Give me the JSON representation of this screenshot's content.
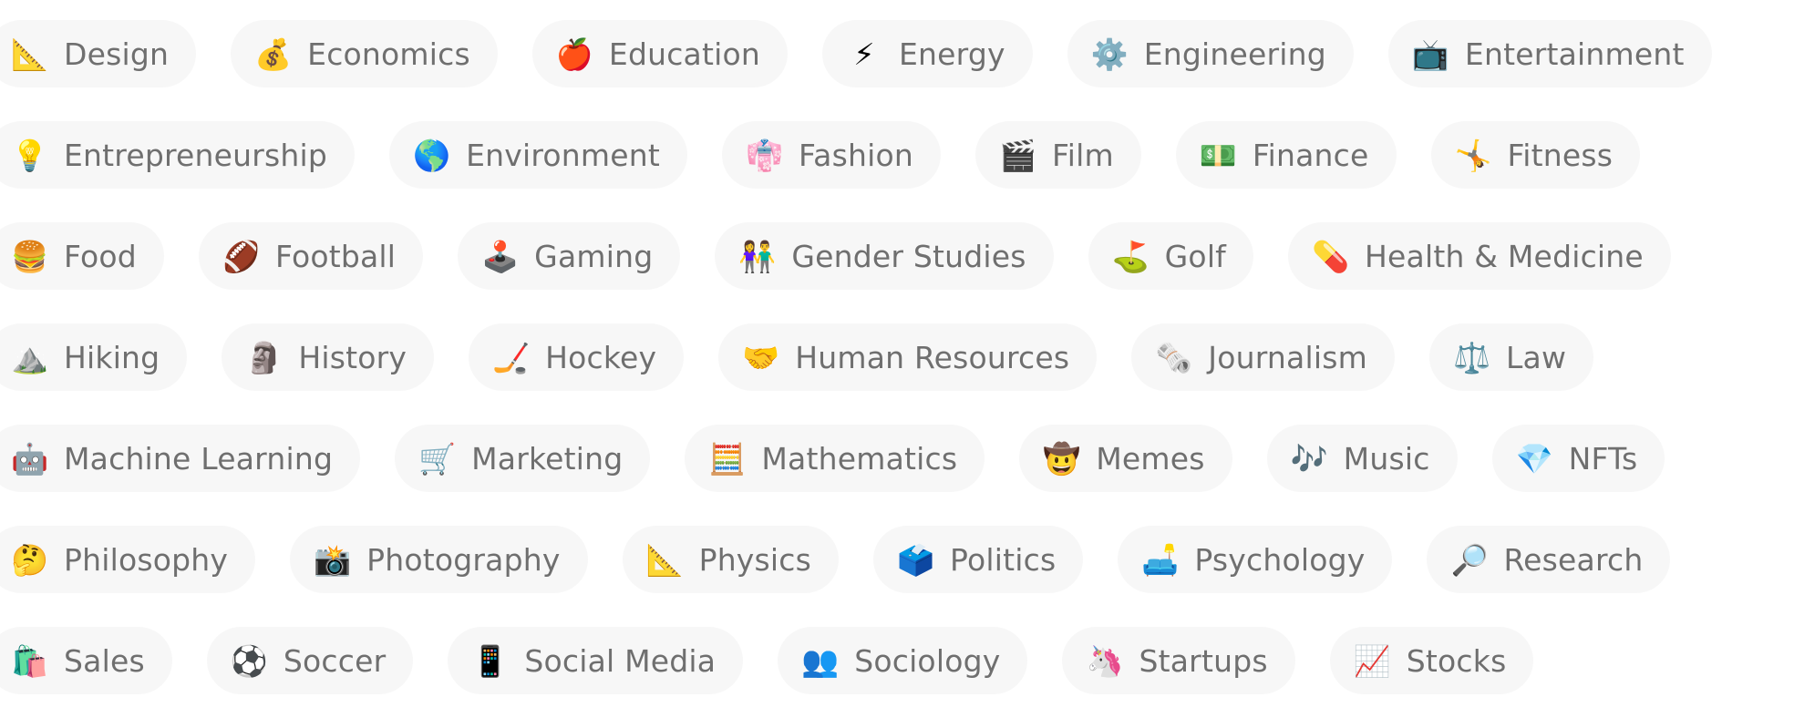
{
  "topics": [
    [
      {
        "icon": "📐",
        "icon_name": "triangular-ruler-icon",
        "label": "Design"
      },
      {
        "icon": "💰",
        "icon_name": "money-bag-icon",
        "label": "Economics"
      },
      {
        "icon": "🍎",
        "icon_name": "red-apple-icon",
        "label": "Education"
      },
      {
        "icon": "⚡",
        "icon_name": "lightning-icon",
        "label": "Energy"
      },
      {
        "icon": "⚙️",
        "icon_name": "gear-icon",
        "label": "Engineering"
      },
      {
        "icon": "📺",
        "icon_name": "television-icon",
        "label": "Entertainment"
      }
    ],
    [
      {
        "icon": "💡",
        "icon_name": "light-bulb-icon",
        "label": "Entrepreneurship"
      },
      {
        "icon": "🌎",
        "icon_name": "globe-icon",
        "label": "Environment"
      },
      {
        "icon": "👘",
        "icon_name": "kimono-icon",
        "label": "Fashion"
      },
      {
        "icon": "🎬",
        "icon_name": "clapper-board-icon",
        "label": "Film"
      },
      {
        "icon": "💵",
        "icon_name": "dollar-banknote-icon",
        "label": "Finance"
      },
      {
        "icon": "🤸",
        "icon_name": "cartwheel-icon",
        "label": "Fitness"
      }
    ],
    [
      {
        "icon": "🍔",
        "icon_name": "hamburger-icon",
        "label": "Food"
      },
      {
        "icon": "🏈",
        "icon_name": "american-football-icon",
        "label": "Football"
      },
      {
        "icon": "🕹️",
        "icon_name": "joystick-icon",
        "label": "Gaming"
      },
      {
        "icon": "👫",
        "icon_name": "couple-icon",
        "label": "Gender Studies"
      },
      {
        "icon": "⛳",
        "icon_name": "golf-flag-icon",
        "label": "Golf"
      },
      {
        "icon": "💊",
        "icon_name": "pill-icon",
        "label": "Health & Medicine"
      }
    ],
    [
      {
        "icon": "⛰️",
        "icon_name": "mountain-icon",
        "label": "Hiking"
      },
      {
        "icon": "🗿",
        "icon_name": "moai-icon",
        "label": "History"
      },
      {
        "icon": "🏒",
        "icon_name": "hockey-stick-icon",
        "label": "Hockey"
      },
      {
        "icon": "🤝",
        "icon_name": "handshake-icon",
        "label": "Human Resources"
      },
      {
        "icon": "🗞️",
        "icon_name": "newspaper-icon",
        "label": "Journalism"
      },
      {
        "icon": "⚖️",
        "icon_name": "balance-scale-icon",
        "label": "Law"
      }
    ],
    [
      {
        "icon": "🤖",
        "icon_name": "robot-icon",
        "label": "Machine Learning"
      },
      {
        "icon": "🛒",
        "icon_name": "shopping-cart-icon",
        "label": "Marketing"
      },
      {
        "icon": "🧮",
        "icon_name": "abacus-icon",
        "label": "Mathematics"
      },
      {
        "icon": "🤠",
        "icon_name": "cowboy-face-icon",
        "label": "Memes"
      },
      {
        "icon": "🎶",
        "icon_name": "music-notes-icon",
        "label": "Music"
      },
      {
        "icon": "💎",
        "icon_name": "gem-icon",
        "label": "NFTs"
      }
    ],
    [
      {
        "icon": "🤔",
        "icon_name": "thinking-face-icon",
        "label": "Philosophy"
      },
      {
        "icon": "📸",
        "icon_name": "camera-flash-icon",
        "label": "Photography"
      },
      {
        "icon": "📐",
        "icon_name": "physics-ruler-icon",
        "label": "Physics"
      },
      {
        "icon": "🗳️",
        "icon_name": "ballot-box-icon",
        "label": "Politics"
      },
      {
        "icon": "🛋️",
        "icon_name": "couch-icon",
        "label": "Psychology"
      },
      {
        "icon": "🔎",
        "icon_name": "magnifying-glass-icon",
        "label": "Research"
      }
    ],
    [
      {
        "icon": "🛍️",
        "icon_name": "shopping-bags-icon",
        "label": "Sales"
      },
      {
        "icon": "⚽",
        "icon_name": "soccer-ball-icon",
        "label": "Soccer"
      },
      {
        "icon": "📱",
        "icon_name": "mobile-phone-icon",
        "label": "Social Media"
      },
      {
        "icon": "👥",
        "icon_name": "people-icon",
        "label": "Sociology"
      },
      {
        "icon": "🦄",
        "icon_name": "unicorn-icon",
        "label": "Startups"
      },
      {
        "icon": "📈",
        "icon_name": "chart-increasing-icon",
        "label": "Stocks"
      }
    ]
  ],
  "colors": {
    "pill_background": "#f7f7f7",
    "label_text": "#6f6f6f",
    "page_background": "#ffffff"
  }
}
